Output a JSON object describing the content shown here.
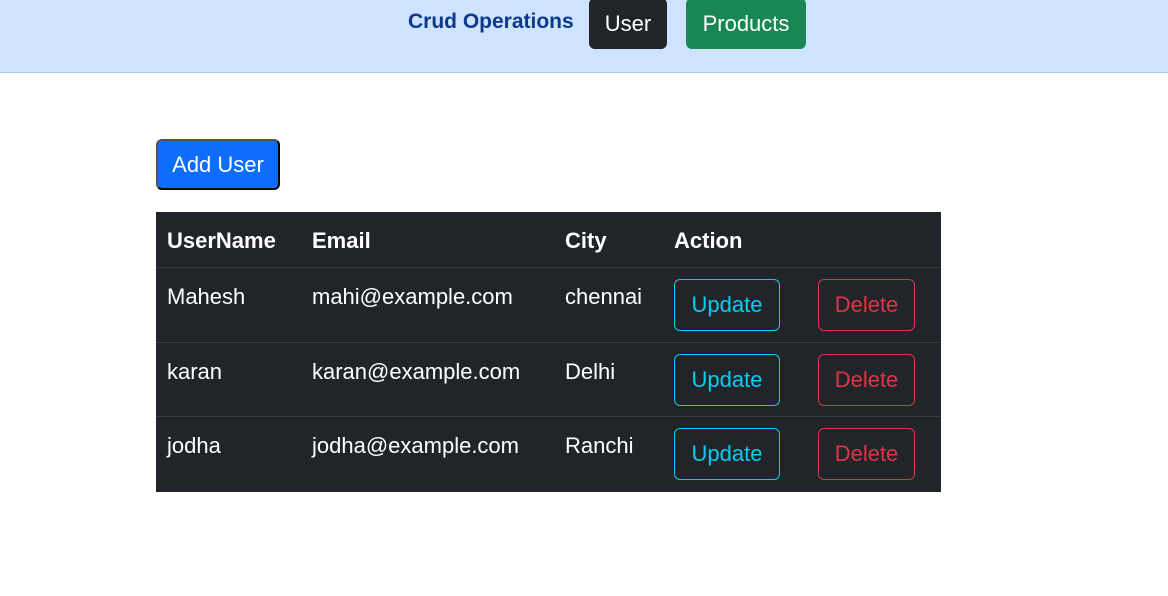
{
  "navbar": {
    "brand": "Crud Operations",
    "user_label": "User",
    "products_label": "Products"
  },
  "main": {
    "add_user_label": "Add User"
  },
  "table": {
    "headers": [
      "UserName",
      "Email",
      "City",
      "Action"
    ],
    "rows": [
      {
        "username": "Mahesh",
        "email": "mahi@example.com",
        "city": "chennai",
        "update_label": "Update",
        "delete_label": "Delete"
      },
      {
        "username": "karan",
        "email": "karan@example.com",
        "city": "Delhi",
        "update_label": "Update",
        "delete_label": "Delete"
      },
      {
        "username": "jodha",
        "email": "jodha@example.com",
        "city": "Ranchi",
        "update_label": "Update",
        "delete_label": "Delete"
      }
    ]
  },
  "colors": {
    "navbar_bg": "#cfe2ff",
    "brand_text": "#0a3a8c",
    "user_button": "#212529",
    "products_button": "#198754",
    "add_button": "#0d6efd",
    "table_bg": "#212529",
    "update_outline": "#0dcaf0",
    "delete_outline": "#dc3545"
  }
}
